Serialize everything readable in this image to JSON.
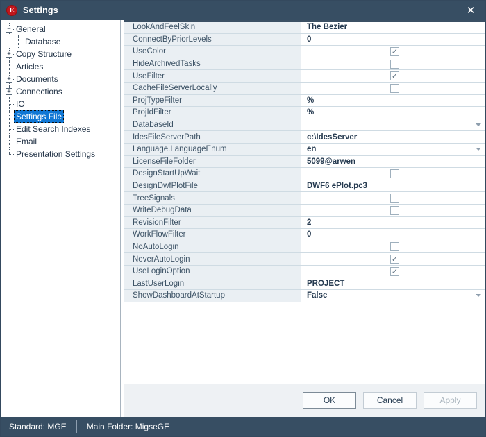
{
  "window": {
    "title": "Settings",
    "logo_letter": "E",
    "logo_color": "#c0171c",
    "titlebar_color": "#374e63",
    "close_icon": "close-icon"
  },
  "tree": {
    "items": [
      {
        "label": "General",
        "level": 0,
        "expander": "minus",
        "selected": false
      },
      {
        "label": "Database",
        "level": 1,
        "expander": "none",
        "selected": false
      },
      {
        "label": "Copy Structure",
        "level": 0,
        "expander": "plus",
        "selected": false
      },
      {
        "label": "Articles",
        "level": 0,
        "expander": "none",
        "selected": false
      },
      {
        "label": "Documents",
        "level": 0,
        "expander": "plus",
        "selected": false
      },
      {
        "label": "Connections",
        "level": 0,
        "expander": "plus",
        "selected": false
      },
      {
        "label": "IO",
        "level": 0,
        "expander": "none",
        "selected": false
      },
      {
        "label": "Settings File",
        "level": 0,
        "expander": "none",
        "selected": true
      },
      {
        "label": "Edit Search Indexes",
        "level": 0,
        "expander": "none",
        "selected": false
      },
      {
        "label": "Email",
        "level": 0,
        "expander": "none",
        "selected": false
      },
      {
        "label": "Presentation Settings",
        "level": 0,
        "expander": "none",
        "selected": false
      }
    ],
    "selection_color": "#1077d4"
  },
  "grid": {
    "rows": [
      {
        "name": "LookAndFeelSkin",
        "type": "text",
        "value": "The Bezier"
      },
      {
        "name": "ConnectByPriorLevels",
        "type": "text",
        "value": "0"
      },
      {
        "name": "UseColor",
        "type": "checkbox",
        "checked": true
      },
      {
        "name": "HideArchivedTasks",
        "type": "checkbox",
        "checked": false
      },
      {
        "name": "UseFilter",
        "type": "checkbox",
        "checked": true
      },
      {
        "name": "CacheFileServerLocally",
        "type": "checkbox",
        "checked": false
      },
      {
        "name": "ProjTypeFilter",
        "type": "text",
        "value": "%"
      },
      {
        "name": "ProjIdFilter",
        "type": "text",
        "value": "%"
      },
      {
        "name": "DatabaseId",
        "type": "dropdown",
        "value": ""
      },
      {
        "name": "IdesFileServerPath",
        "type": "text",
        "value": "c:\\IdesServer"
      },
      {
        "name": "Language.LanguageEnum",
        "type": "dropdown",
        "value": "en"
      },
      {
        "name": "LicenseFileFolder",
        "type": "text",
        "value": "5099@arwen"
      },
      {
        "name": "DesignStartUpWait",
        "type": "checkbox",
        "checked": false
      },
      {
        "name": "DesignDwfPlotFile",
        "type": "text",
        "value": "DWF6 ePlot.pc3"
      },
      {
        "name": "TreeSignals",
        "type": "checkbox",
        "checked": false
      },
      {
        "name": "WriteDebugData",
        "type": "checkbox",
        "checked": false
      },
      {
        "name": "RevisionFilter",
        "type": "text",
        "value": "2"
      },
      {
        "name": "WorkFlowFilter",
        "type": "text",
        "value": "0"
      },
      {
        "name": "NoAutoLogin",
        "type": "checkbox",
        "checked": false
      },
      {
        "name": "NeverAutoLogin",
        "type": "checkbox",
        "checked": true
      },
      {
        "name": "UseLoginOption",
        "type": "checkbox",
        "checked": true
      },
      {
        "name": "LastUserLogin",
        "type": "text",
        "value": "PROJECT"
      },
      {
        "name": "ShowDashboardAtStartup",
        "type": "dropdown",
        "value": "False"
      }
    ],
    "check_glyph": "✓"
  },
  "buttons": {
    "ok": "OK",
    "cancel": "Cancel",
    "apply": "Apply"
  },
  "statusbar": {
    "standard": "Standard: MGE",
    "main_folder": "Main Folder: MigseGE"
  }
}
